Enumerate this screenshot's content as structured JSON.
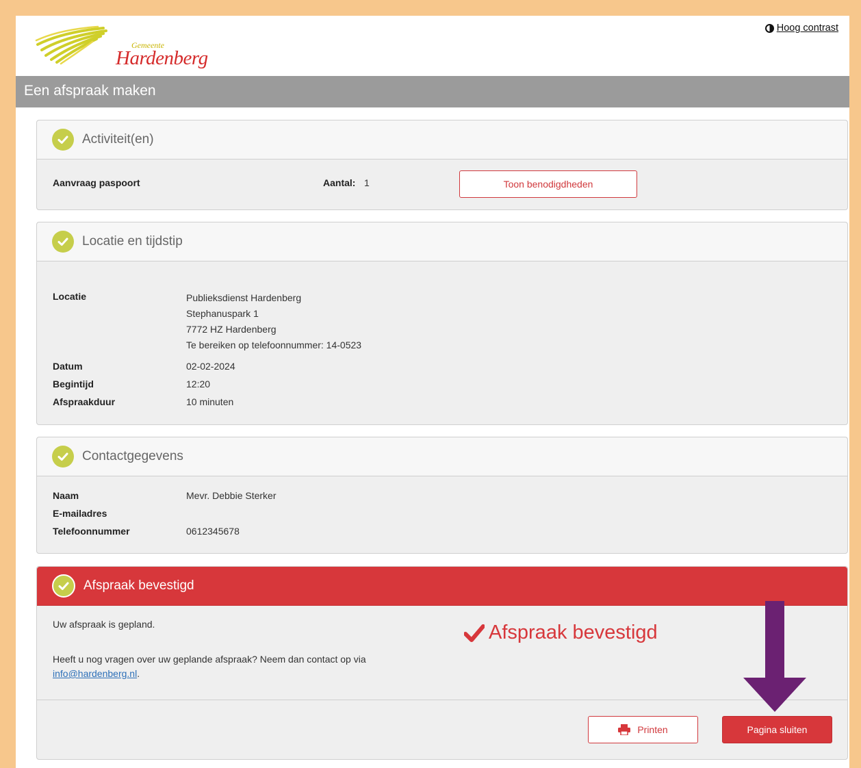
{
  "header": {
    "logo_small": "Gemeente",
    "logo_big": "Hardenberg",
    "contrast_label": "Hoog contrast"
  },
  "page_title": "Een afspraak maken",
  "sections": {
    "activities": {
      "title": "Activiteit(en)",
      "item": "Aanvraag paspoort",
      "count_label": "Aantal:",
      "count_value": "1",
      "button": "Toon benodigdheden"
    },
    "location": {
      "title": "Locatie en tijdstip",
      "location_label": "Locatie",
      "address_lines": [
        "Publieksdienst Hardenberg",
        "Stephanuspark 1",
        "7772 HZ Hardenberg",
        "Te bereiken op telefoonnummer: 14-0523"
      ],
      "date_label": "Datum",
      "date_value": "02-02-2024",
      "start_label": "Begintijd",
      "start_value": "12:20",
      "duration_label": "Afspraakduur",
      "duration_value": "10 minuten"
    },
    "contact": {
      "title": "Contactgegevens",
      "name_label": "Naam",
      "name_value": "Mevr. Debbie Sterker",
      "email_label": "E-mailadres",
      "email_value": "",
      "phone_label": "Telefoonnummer",
      "phone_value": "0612345678"
    },
    "confirmed": {
      "title": "Afspraak bevestigd",
      "line1": "Uw afspraak is gepland.",
      "line2": "Heeft u nog vragen over uw geplande afspraak? Neem dan contact op via",
      "email": "info@hardenberg.nl",
      "email_suffix": ".",
      "stamp": "Afspraak bevestigd",
      "print_button": "Printen",
      "close_button": "Pagina sluiten"
    }
  },
  "colors": {
    "accent_red": "#d7373b",
    "check_green": "#c6ce4b",
    "title_bar": "#9b9b9b",
    "frame_orange": "#f7c78c",
    "arrow_purple": "#6b2172"
  }
}
